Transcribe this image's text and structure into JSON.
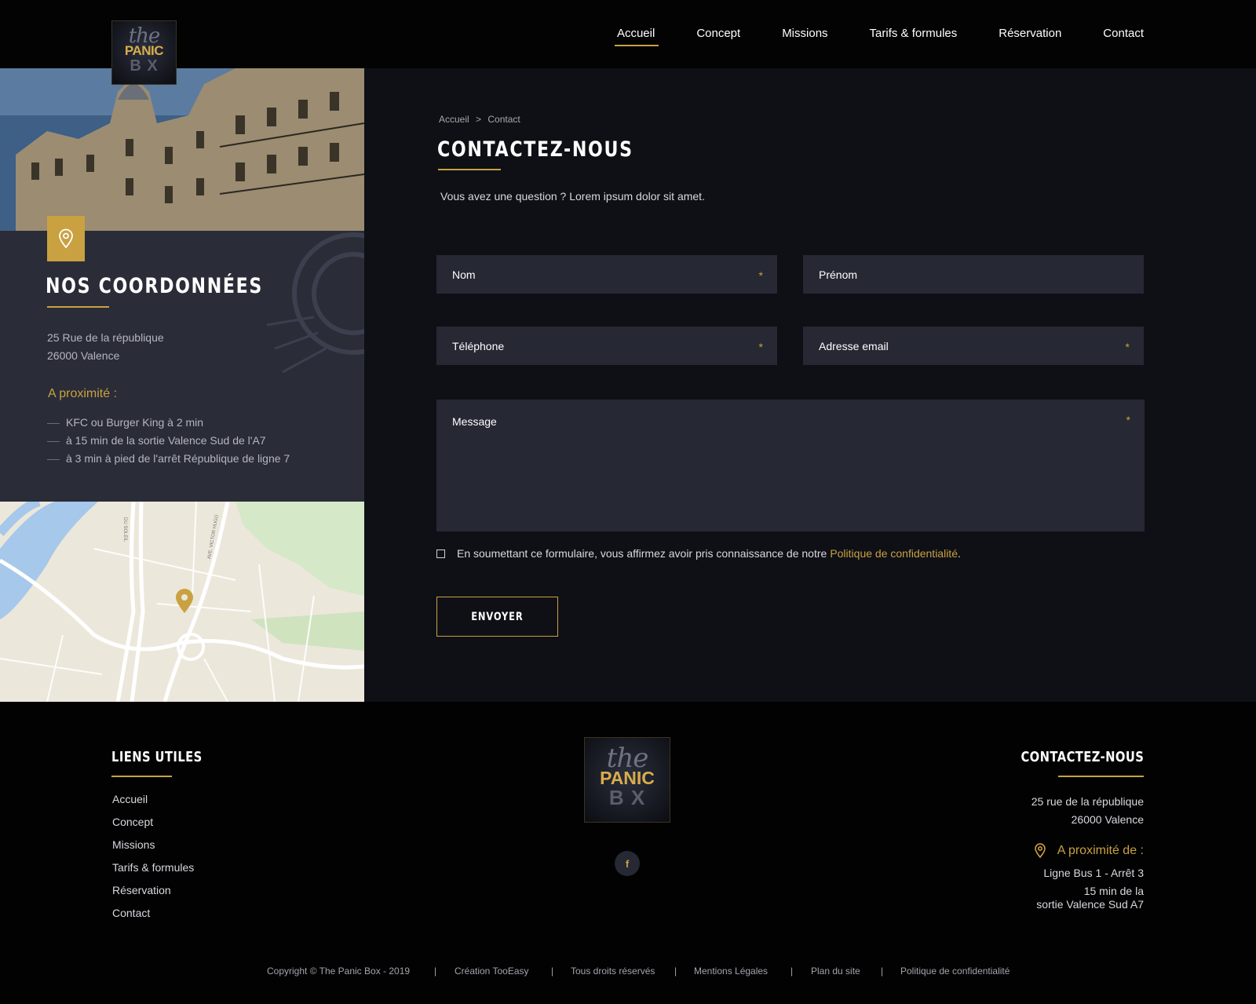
{
  "header": {
    "logo": {
      "the": "the",
      "panic": "PANIC",
      "box": "B X"
    },
    "nav": [
      "Accueil",
      "Concept",
      "Missions",
      "Tarifs & formules",
      "Réservation",
      "Contact"
    ]
  },
  "left": {
    "title": "NOS COORDONNÉES",
    "address_line1": "25 Rue de la république",
    "address_line2": "26000 Valence",
    "proximity_title": "A proximité :",
    "proximity_items": [
      "KFC ou Burger King à 2 min",
      "à 15 min de la sortie Valence Sud de l'A7",
      "à 3 min à pied de l'arrêt République de ligne 7"
    ],
    "map_labels": {
      "street1": "AVE. VICTOR HUGO",
      "street2": "DU SOLEIL"
    }
  },
  "main": {
    "breadcrumb": {
      "home": "Accueil",
      "sep": ">",
      "current": "Contact"
    },
    "title": "CONTACTEZ-NOUS",
    "intro": "Vous avez une question ? Lorem ipsum dolor sit amet.",
    "fields": {
      "nom": "Nom",
      "prenom": "Prénom",
      "telephone": "Téléphone",
      "email": "Adresse email",
      "message": "Message",
      "required_mark": "*"
    },
    "consent_text": "En soumettant ce formulaire, vous affirmez avoir pris connaissance de notre",
    "consent_link": "Politique de confidentialité",
    "consent_end": ".",
    "submit": "ENVOYER"
  },
  "footer": {
    "links_title": "LIENS UTILES",
    "links": [
      "Accueil",
      "Concept",
      "Missions",
      "Tarifs & formules",
      "Réservation",
      "Contact"
    ],
    "facebook": "f",
    "contact_title": "CONTACTEZ-NOUS",
    "address_line1": "25 rue de la république",
    "address_line2": "26000 Valence",
    "proximity_title": "A proximité de :",
    "proximity_line1": "Ligne Bus 1 - Arrêt 3",
    "proximity_line2": "15 min de la",
    "proximity_line3": "sortie Valence Sud A7",
    "bottom": {
      "copyright": "Copyright © The Panic Box - 2019",
      "creation": "Création TooEasy",
      "rights": "Tous droits réservés",
      "legal": "Mentions Légales",
      "sitemap": "Plan du site",
      "privacy": "Politique de confidentialité",
      "separator": "|"
    }
  },
  "colors": {
    "accent": "#c9a140",
    "panel": "#2a2c38",
    "field": "#262834",
    "main_bg": "#0f1016"
  }
}
